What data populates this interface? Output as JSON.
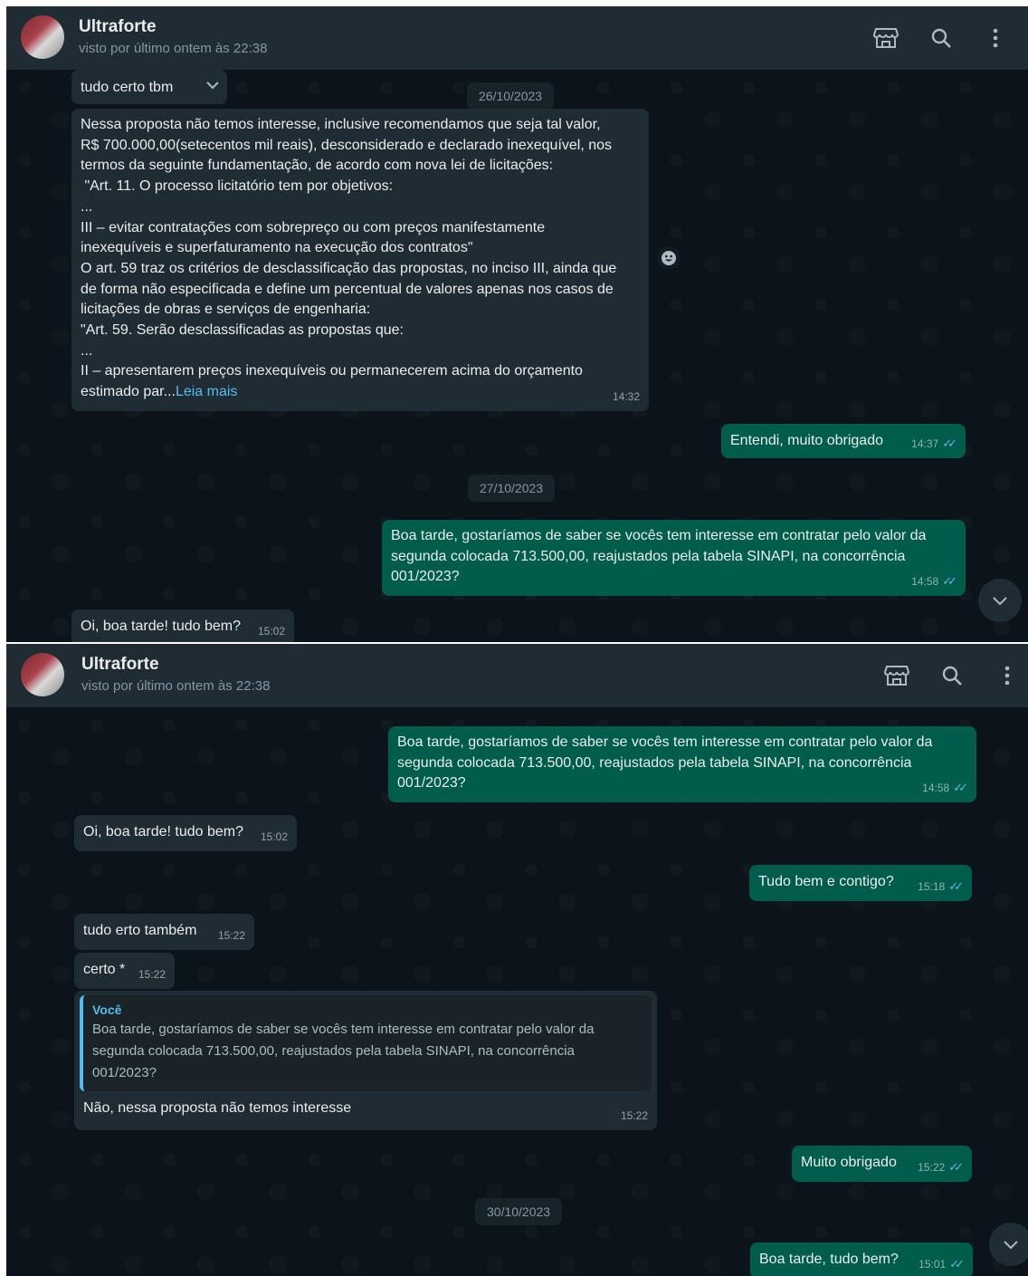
{
  "contact": {
    "name": "Ultraforte",
    "last_seen": "visto por último ontem às 22:38"
  },
  "icons": {
    "store": "store-icon",
    "search": "search-icon",
    "menu": "kebab-menu-icon",
    "scroll": "chevron-down-icon"
  },
  "colors": {
    "panel_bg": "#0b141a",
    "header_bg": "#202c33",
    "incoming": "#202c33",
    "outgoing": "#005c4b",
    "link": "#53bdeb"
  },
  "screen1": {
    "msg_tudo_certo": {
      "text": "tudo certo tbm",
      "time": ""
    },
    "date_1": "26/10/2023",
    "msg_long": {
      "text": "Nessa proposta não temos interesse, inclusive recomendamos que seja tal valor,\nR$ 700.000,00(setecentos mil reais), desconsiderado e declarado inexequível, nos\ntermos da seguinte fundamentação, de acordo com nova lei de licitações:\n \"Art. 11. O processo licitatório tem por objetivos:\n...\nIII – evitar contratações com sobrepreço ou com preços manifestamente\ninexequíveis e superfaturamento na execução dos contratos\"\nO art. 59 traz os critérios de desclassificação das propostas, no inciso III, ainda que\nde forma não especificada e define um percentual de valores apenas nos casos de\nlicitações de obras e serviços de engenharia:\n\"Art. 59. Serão desclassificadas as propostas que:\n...\nII – apresentarem preços inexequíveis ou permanecerem acima do orçamento\nestimado par...",
      "read_more": "Leia mais",
      "time": "14:32"
    },
    "msg_entendi": {
      "text": "Entendi, muito obrigado",
      "time": "14:37"
    },
    "date_2": "27/10/2023",
    "msg_boa_tarde": {
      "text": "Boa tarde, gostaríamos de saber se vocês tem interesse em contratar pelo valor da\nsegunda colocada 713.500,00, reajustados pela tabela SINAPI, na concorrência\n001/2023?",
      "time": "14:58"
    },
    "msg_oi": {
      "text": "Oi, boa tarde! tudo bem?",
      "time": "15:02"
    }
  },
  "screen2": {
    "msg_boa_tarde": {
      "text": "Boa tarde, gostaríamos de saber se vocês tem interesse em contratar pelo valor da\nsegunda colocada 713.500,00, reajustados pela tabela SINAPI, na concorrência\n001/2023?",
      "time": "14:58"
    },
    "msg_oi": {
      "text": "Oi, boa tarde! tudo bem?",
      "time": "15:02"
    },
    "msg_tudo_bem": {
      "text": "Tudo bem e contigo?",
      "time": "15:18"
    },
    "msg_tudo_erto": {
      "text": "tudo erto também",
      "time": "15:22"
    },
    "msg_certo": {
      "text": "certo *",
      "time": "15:22"
    },
    "msg_reply": {
      "quote_author": "Você",
      "quote_text": "Boa tarde, gostaríamos de saber se vocês tem interesse em contratar pelo valor da\nsegunda colocada 713.500,00, reajustados pela tabela SINAPI, na concorrência\n001/2023?",
      "text": "Não, nessa proposta não temos interesse",
      "time": "15:22"
    },
    "msg_muito_obrigado": {
      "text": "Muito obrigado",
      "time": "15:22"
    },
    "date_3": "30/10/2023",
    "msg_boa_tarde_tudo_bem": {
      "text": "Boa tarde, tudo bem?",
      "time": "15:01"
    }
  }
}
